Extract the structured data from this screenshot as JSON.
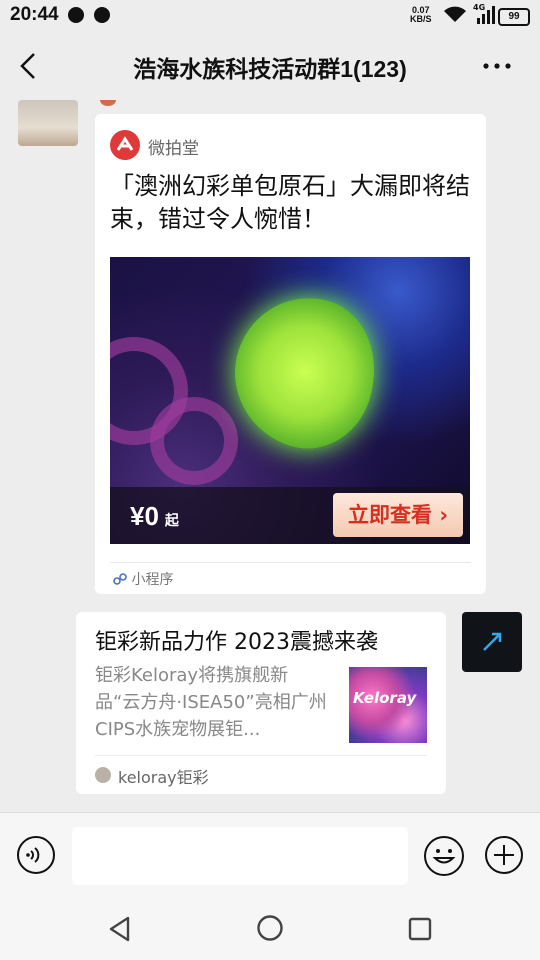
{
  "status_bar": {
    "time": "20:44",
    "net_speed_value": "0.07",
    "net_speed_unit": "KB/S",
    "signal_label": "4G",
    "battery": "99"
  },
  "header": {
    "title": "浩海水族科技活动群1(123)"
  },
  "messages": {
    "mini_program": {
      "app_name": "微拍堂",
      "title": "「澳洲幻彩单包原石」大漏即将结束，错过令人惋惜！",
      "price": "¥0",
      "price_suffix": "起",
      "cta_label": "立即查看",
      "type_label": "小程序"
    },
    "link_card": {
      "title": "钜彩新品力作 2023震撼来袭",
      "description": "钜彩Keloray将携旗舰新品“云方舟·ISEA50”亮相广州CIPS水族宠物展钜...",
      "thumb_text": "Keloray",
      "source": "keloray钜彩"
    }
  },
  "colors": {
    "background": "#ededed",
    "cta_text": "#d62f1f",
    "mini_logo": "#e0393a"
  },
  "icons": [
    "wechat-icon",
    "chat-bubble-icon",
    "wifi-icon",
    "signal-icon",
    "battery-icon",
    "back-arrow-icon",
    "more-icon",
    "mini-program-icon",
    "voice-icon",
    "emoji-icon",
    "plus-icon",
    "nav-back-icon",
    "nav-home-icon",
    "nav-recent-icon"
  ]
}
